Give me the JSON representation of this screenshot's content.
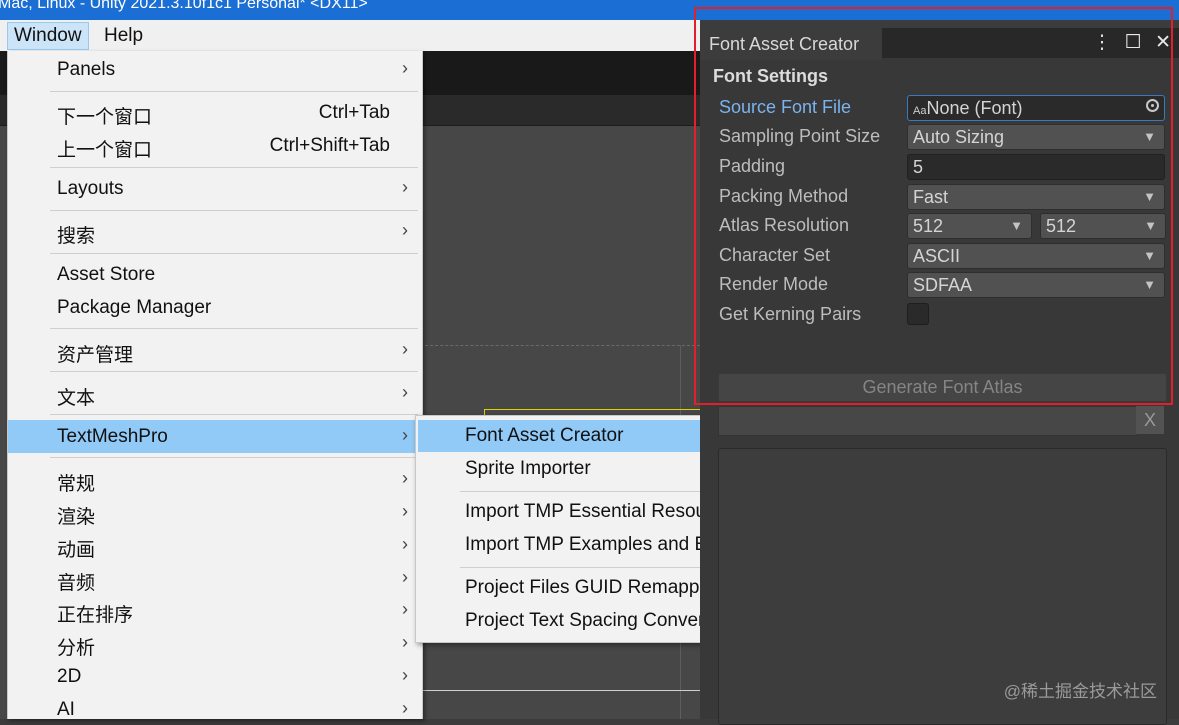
{
  "window": {
    "title": "Mac, Linux - Unity 2021.3.10f1c1 Personal* <DX11>"
  },
  "menubar": {
    "items": [
      "Window",
      "Help"
    ]
  },
  "window_menu": {
    "items": [
      {
        "label": "Panels",
        "shortcut": "",
        "arrow": "›"
      },
      {
        "label": "下一个窗口",
        "shortcut": "Ctrl+Tab",
        "arrow": ""
      },
      {
        "label": "上一个窗口",
        "shortcut": "Ctrl+Shift+Tab",
        "arrow": ""
      },
      {
        "label": "Layouts",
        "shortcut": "",
        "arrow": "›"
      },
      {
        "label": "搜索",
        "shortcut": "",
        "arrow": "›"
      },
      {
        "label": "Asset Store",
        "shortcut": "",
        "arrow": ""
      },
      {
        "label": "Package Manager",
        "shortcut": "",
        "arrow": ""
      },
      {
        "label": "资产管理",
        "shortcut": "",
        "arrow": "›"
      },
      {
        "label": "文本",
        "shortcut": "",
        "arrow": "›"
      },
      {
        "label": "TextMeshPro",
        "shortcut": "",
        "arrow": "›"
      },
      {
        "label": "常规",
        "shortcut": "",
        "arrow": "›"
      },
      {
        "label": "渲染",
        "shortcut": "",
        "arrow": "›"
      },
      {
        "label": "动画",
        "shortcut": "",
        "arrow": "›"
      },
      {
        "label": "音频",
        "shortcut": "",
        "arrow": "›"
      },
      {
        "label": "正在排序",
        "shortcut": "",
        "arrow": "›"
      },
      {
        "label": "分析",
        "shortcut": "",
        "arrow": "›"
      },
      {
        "label": "2D",
        "shortcut": "",
        "arrow": "›"
      },
      {
        "label": "AI",
        "shortcut": "",
        "arrow": "›"
      }
    ]
  },
  "tmp_submenu": {
    "items": [
      "Font Asset Creator",
      "Sprite Importer",
      "Import TMP Essential Resources",
      "Import TMP Examples and Extras",
      "Project Files GUID Remapping Tool",
      "Project Text Spacing Conversion Tool"
    ]
  },
  "font_asset_creator": {
    "tab_title": "Font Asset Creator",
    "tab_icons": [
      "⋮",
      "☐",
      "✕"
    ],
    "section_title": "Font Settings",
    "source_font_label": "Source Font File",
    "source_font_value": "None (Font)",
    "source_font_prefix": "Aa",
    "sampling_label": "Sampling Point Size",
    "sampling_value": "Auto Sizing",
    "padding_label": "Padding",
    "padding_value": "5",
    "packing_label": "Packing Method",
    "packing_value": "Fast",
    "atlas_label": "Atlas Resolution",
    "atlas_width": "512",
    "atlas_height": "512",
    "charset_label": "Character Set",
    "charset_value": "ASCII",
    "render_label": "Render Mode",
    "render_value": "SDFAA",
    "kerning_label": "Get Kerning Pairs",
    "kerning_checked": false,
    "generate_label": "Generate Font Atlas",
    "clear_label": "X"
  },
  "watermark": "@稀土掘金技术社区",
  "colors": {
    "title_bar": "#1b6fd4",
    "highlight": "#91c9f7",
    "callout_box": "#e0202a",
    "link_label": "#7bb3ef"
  }
}
